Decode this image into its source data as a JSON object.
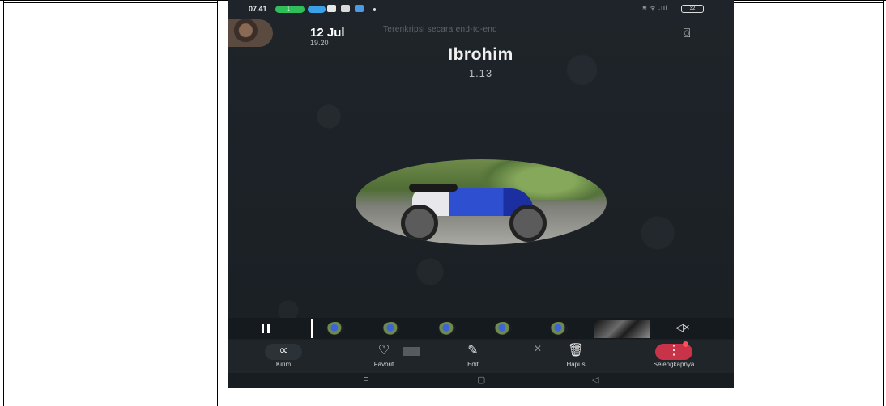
{
  "statusbar": {
    "time": "07.41",
    "pill_count": "1",
    "signal_text": "≋ ᯤ .ııl",
    "battery": "32"
  },
  "header": {
    "date": "12 Jul",
    "time": "19.20",
    "encryption_note": "Terenkripsi secara end-to-end"
  },
  "call": {
    "contact_name": "Ibrohim",
    "duration": "1.13"
  },
  "icons": {
    "camera": "camera-switch-icon",
    "pause": "pause-icon",
    "mute": "speaker-mute-icon",
    "share": "share-icon",
    "heart": "heart-icon",
    "pencil": "pencil-icon",
    "trash": "trash-icon",
    "more": "more-vertical-icon"
  },
  "glyphs": {
    "camera": "⌼",
    "mute": "◁×",
    "share": "∝",
    "heart": "♡",
    "pencil": "✎",
    "trash": "🗑",
    "more": "⋮",
    "mic_off": "✕",
    "nav_menu": "≡",
    "nav_home": "▢",
    "nav_back": "◁"
  },
  "actions": {
    "kirim": "Kirim",
    "favorit": "Favorit",
    "edit": "Edit",
    "hapus": "Hapus",
    "more": "Selengkapnya"
  },
  "colors": {
    "background": "#1b2126",
    "accent_red": "#c8334a",
    "status_green": "#2fbf5a"
  }
}
